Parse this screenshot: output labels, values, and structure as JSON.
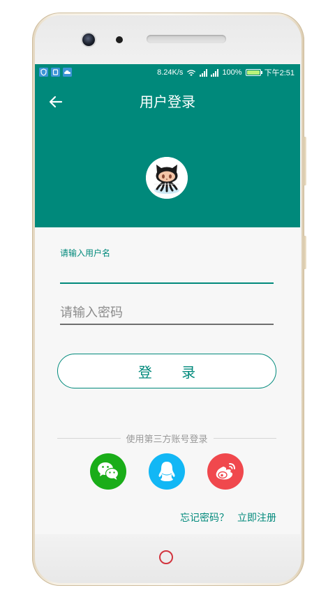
{
  "status_bar": {
    "speed": "8.24K/s",
    "battery_percent": "100%",
    "battery_level": 1.0,
    "time": "下午2:51",
    "icons": [
      "shield-icon",
      "app-icon",
      "cloud-icon",
      "wifi-icon",
      "signal-icon",
      "signal-icon",
      "battery-icon"
    ]
  },
  "header": {
    "title": "用户登录",
    "back_icon": "arrow-left-icon",
    "avatar_icon": "octocat-avatar"
  },
  "form": {
    "username": {
      "label": "请输入用户名",
      "value": ""
    },
    "password": {
      "placeholder": "请输入密码",
      "value": ""
    },
    "login_button": "登 录"
  },
  "third_party": {
    "label": "使用第三方账号登录",
    "providers": [
      {
        "name": "wechat",
        "icon": "wechat-icon",
        "color": "#1aad19"
      },
      {
        "name": "qq",
        "icon": "qq-icon",
        "color": "#12b7f5"
      },
      {
        "name": "weibo",
        "icon": "weibo-icon",
        "color": "#f0484d"
      }
    ]
  },
  "links": {
    "forgot_password": "忘记密码？",
    "register": "立即注册"
  },
  "colors": {
    "primary": "#00897b",
    "background": "#f7f7f7"
  }
}
